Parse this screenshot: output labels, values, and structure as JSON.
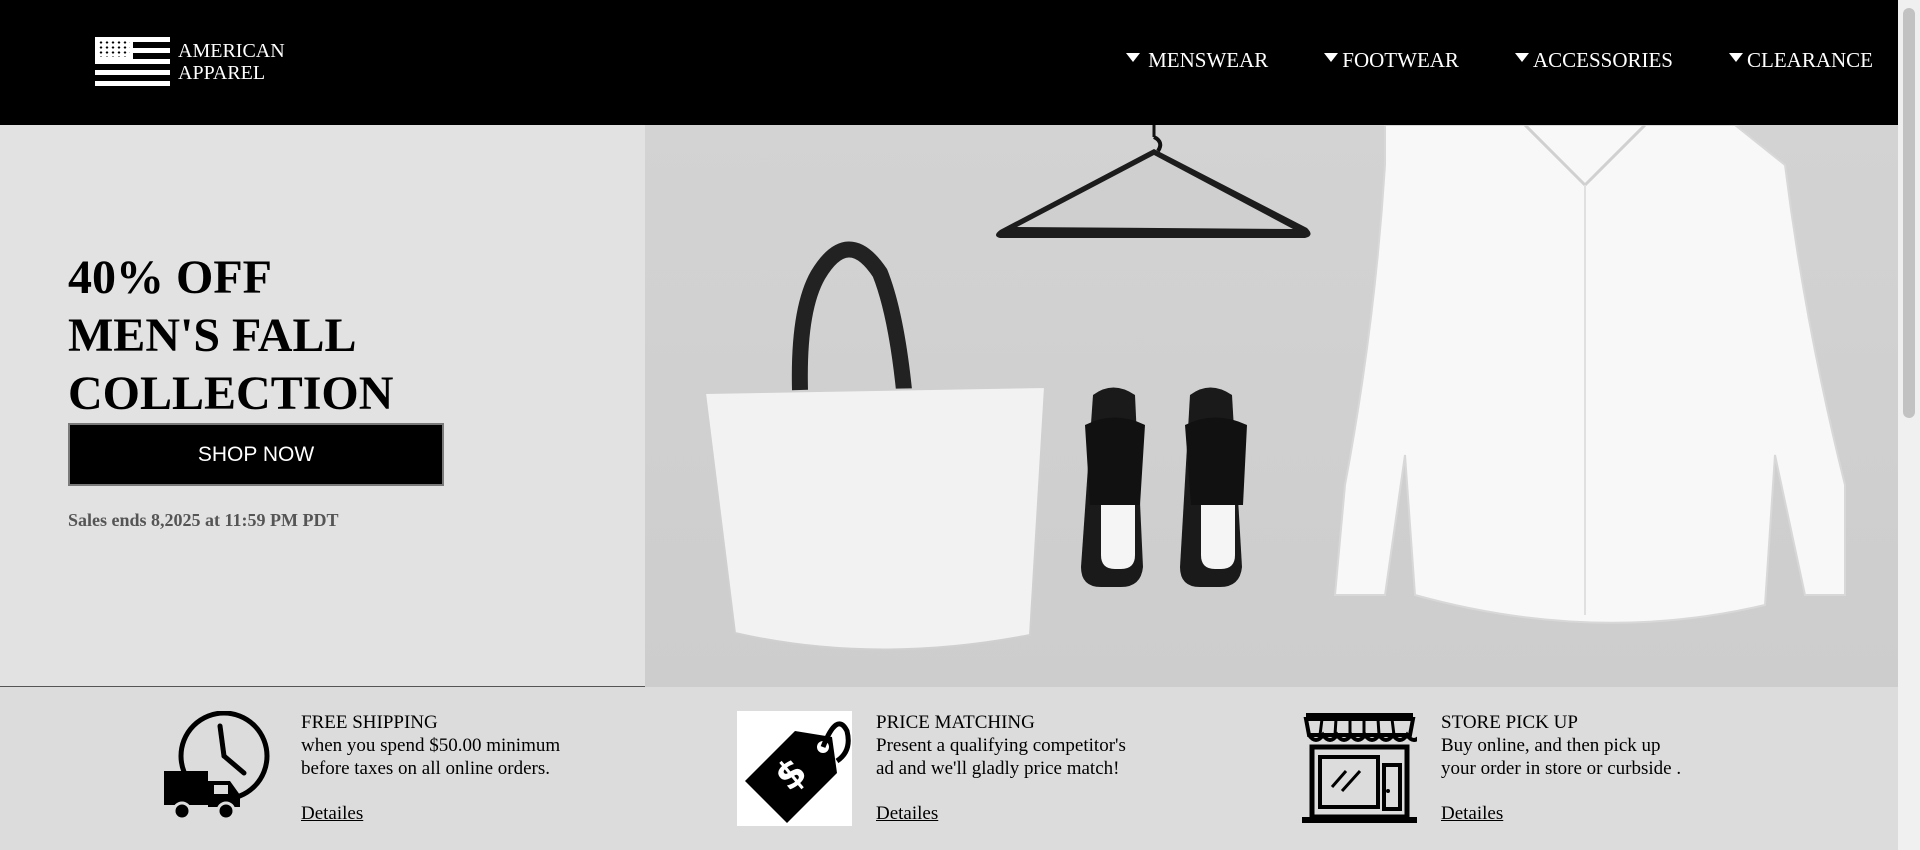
{
  "brand": {
    "line1": "AMERICAN",
    "line2": "APPAREL"
  },
  "nav": [
    {
      "label": "MENSWEAR"
    },
    {
      "label": "FOOTWEAR"
    },
    {
      "label": "ACCESSORIES"
    },
    {
      "label": "CLEARANCE"
    }
  ],
  "hero": {
    "headline": [
      "40% OFF",
      "MEN'S FALL",
      "COLLECTION"
    ],
    "cta": "SHOP NOW",
    "sale_note": "Sales ends 8,2025 at 11:59 PM PDT"
  },
  "features": [
    {
      "icon": "delivery-truck-clock-icon",
      "title": "FREE SHIPPING",
      "desc": [
        "when you spend $50.00 minimum",
        "before taxes on all online orders."
      ],
      "link": "Detailes"
    },
    {
      "icon": "price-tag-icon",
      "title": "PRICE MATCHING",
      "desc": [
        "Present a qualifying competitor's",
        "ad and we'll gladly price match!"
      ],
      "link": "Detailes"
    },
    {
      "icon": "storefront-icon",
      "title": "STORE PICK UP",
      "desc": [
        "Buy online, and then pick up",
        "your order in store or curbside ."
      ],
      "link": "Detailes"
    }
  ],
  "colors": {
    "header_bg": "#000000",
    "hero_bg": "#e2e2e2",
    "features_bg": "#dcdcdc",
    "accent": "#000000"
  }
}
